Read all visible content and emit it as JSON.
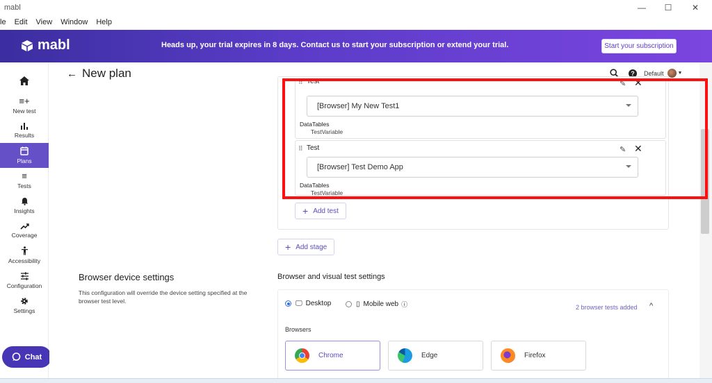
{
  "window": {
    "title": "mabl",
    "minimize": "—",
    "maximize": "☐",
    "close": "✕"
  },
  "menu": [
    "le",
    "Edit",
    "View",
    "Window",
    "Help"
  ],
  "banner": {
    "logo": "mabl",
    "message": "Heads up, your trial expires in 8 days. Contact us to start your subscription or extend your trial.",
    "button": "Start your subscription"
  },
  "sidebar": {
    "items": [
      {
        "label": "",
        "icon": "home-icon"
      },
      {
        "label": "New test",
        "icon": "new-test-icon"
      },
      {
        "label": "Results",
        "icon": "results-icon"
      },
      {
        "label": "Plans",
        "icon": "plans-icon"
      },
      {
        "label": "Tests",
        "icon": "tests-icon"
      },
      {
        "label": "Insights",
        "icon": "bell-icon"
      },
      {
        "label": "Coverage",
        "icon": "trend-icon"
      },
      {
        "label": "Accessibility",
        "icon": "accessibility-icon"
      },
      {
        "label": "Configuration",
        "icon": "sliders-icon"
      },
      {
        "label": "Settings",
        "icon": "gear-icon"
      }
    ],
    "chat": "Chat"
  },
  "header": {
    "title": "New plan",
    "workspace": "Default"
  },
  "tests": [
    {
      "label": "Test",
      "selected": "[Browser] My New Test1",
      "datatables_label": "DataTables",
      "datatable": "TestVariable"
    },
    {
      "label": "Test",
      "selected": "[Browser] Test Demo App",
      "datatables_label": "DataTables",
      "datatable": "TestVariable"
    }
  ],
  "add_test": "Add test",
  "add_stage": "Add stage",
  "browser_device": {
    "title": "Browser device settings",
    "description": "This configuration will override the device setting specified at the browser test level."
  },
  "browser_visual": {
    "title": "Browser and visual test settings",
    "desktop": "Desktop",
    "mobile": "Mobile web",
    "desktop_selected": true,
    "added": "2 browser tests added",
    "browsers_label": "Browsers",
    "browsers": [
      "Chrome",
      "Edge",
      "Firefox"
    ]
  },
  "colors": {
    "accent": "#6650c8",
    "highlight": "#ff1010"
  }
}
